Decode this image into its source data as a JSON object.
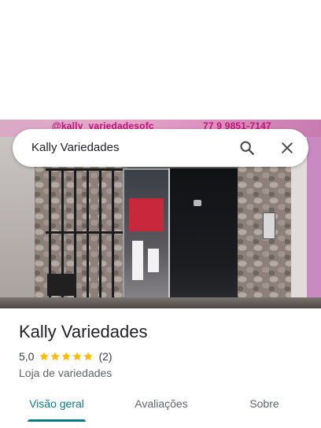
{
  "search": {
    "query": "Kally Variedades",
    "search_icon": "search-icon",
    "close_icon": "close-icon"
  },
  "photo": {
    "banner_handle": "@kally_variedadesofc",
    "banner_phone": "77 9 9851-7147"
  },
  "place": {
    "name": "Kally Variedades",
    "rating": "5,0",
    "stars": 5,
    "review_count": "(2)",
    "category": "Loja de variedades"
  },
  "tabs": [
    {
      "label": "Visão geral",
      "active": true
    },
    {
      "label": "Avaliações",
      "active": false
    },
    {
      "label": "Sobre",
      "active": false
    }
  ],
  "colors": {
    "accent": "#0b7a80",
    "star": "#fbbc04",
    "text_primary": "#202124",
    "text_secondary": "#5f6368"
  }
}
